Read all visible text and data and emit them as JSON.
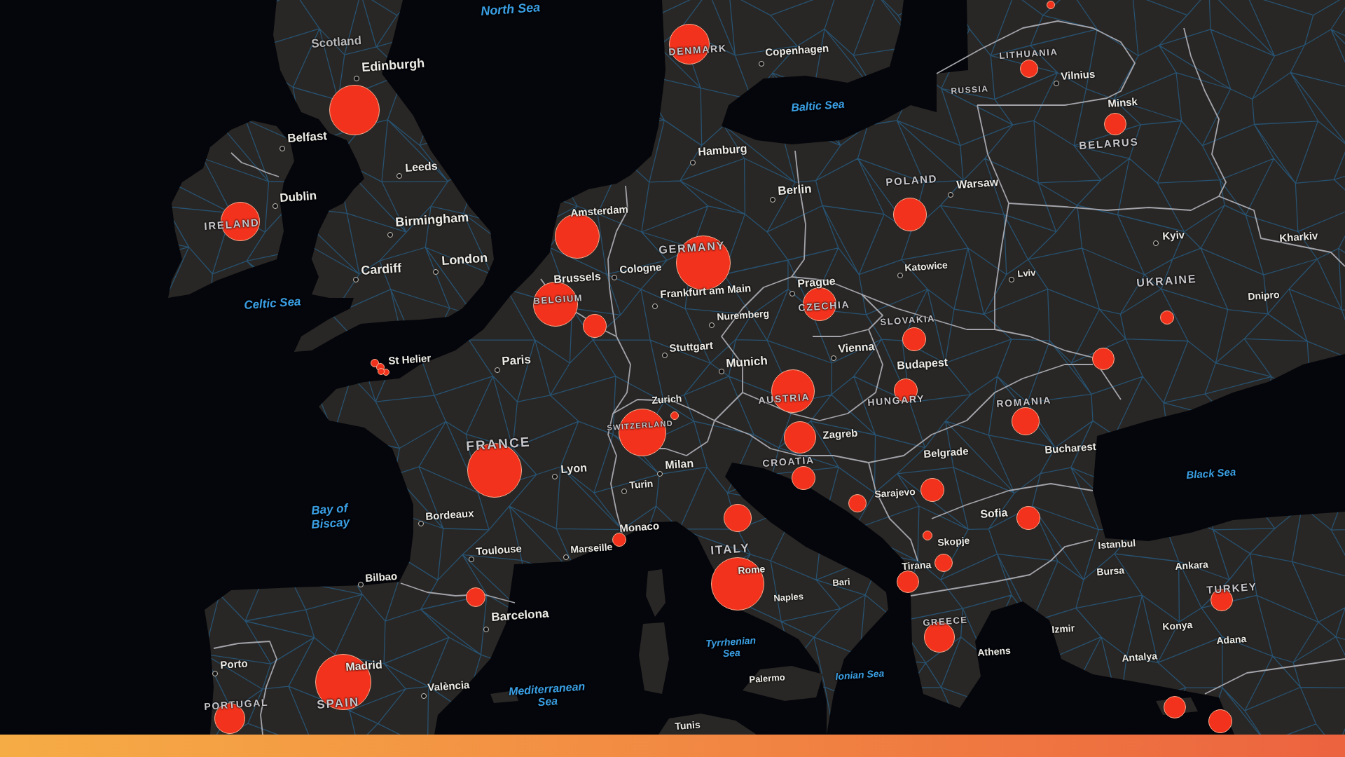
{
  "map": {
    "labels": [
      {
        "text": "North Sea",
        "kind": "sea"
      },
      {
        "text": "Scotland",
        "kind": "region"
      },
      {
        "text": "DENMARK",
        "kind": "country"
      },
      {
        "text": "Copenhagen",
        "kind": "city"
      },
      {
        "text": "LITHUANIA",
        "kind": "country"
      },
      {
        "text": "Edinburgh",
        "kind": "city"
      },
      {
        "text": "Vilnius",
        "kind": "city"
      },
      {
        "text": "RUSSIA",
        "kind": "country"
      },
      {
        "text": "Minsk",
        "kind": "city"
      },
      {
        "text": "Baltic Sea",
        "kind": "sea"
      },
      {
        "text": "Belfast",
        "kind": "city"
      },
      {
        "text": "BELARUS",
        "kind": "country"
      },
      {
        "text": "Hamburg",
        "kind": "city"
      },
      {
        "text": "Leeds",
        "kind": "city"
      },
      {
        "text": "POLAND",
        "kind": "country"
      },
      {
        "text": "Warsaw",
        "kind": "city"
      },
      {
        "text": "Berlin",
        "kind": "city"
      },
      {
        "text": "Dublin",
        "kind": "city"
      },
      {
        "text": "Amsterdam",
        "kind": "city"
      },
      {
        "text": "Birmingham",
        "kind": "city"
      },
      {
        "text": "IRELAND",
        "kind": "country"
      },
      {
        "text": "Kyiv",
        "kind": "city"
      },
      {
        "text": "Kharkiv",
        "kind": "city"
      },
      {
        "text": "GERMANY",
        "kind": "country"
      },
      {
        "text": "London",
        "kind": "city"
      },
      {
        "text": "Cologne",
        "kind": "city"
      },
      {
        "text": "Cardiff",
        "kind": "city"
      },
      {
        "text": "Katowice",
        "kind": "city"
      },
      {
        "text": "Brussels",
        "kind": "city"
      },
      {
        "text": "Lviv",
        "kind": "city"
      },
      {
        "text": "UKRAINE",
        "kind": "country"
      },
      {
        "text": "Prague",
        "kind": "city"
      },
      {
        "text": "Frankfurt am Main",
        "kind": "city"
      },
      {
        "text": "Dnipro",
        "kind": "city"
      },
      {
        "text": "BELGIUM",
        "kind": "country"
      },
      {
        "text": "CZECHIA",
        "kind": "country"
      },
      {
        "text": "Celtic Sea",
        "kind": "sea"
      },
      {
        "text": "Nuremberg",
        "kind": "city"
      },
      {
        "text": "SLOVAKIA",
        "kind": "country"
      },
      {
        "text": "Stuttgart",
        "kind": "city"
      },
      {
        "text": "Vienna",
        "kind": "city"
      },
      {
        "text": "Paris",
        "kind": "city"
      },
      {
        "text": "St Helier",
        "kind": "city"
      },
      {
        "text": "Munich",
        "kind": "city"
      },
      {
        "text": "Budapest",
        "kind": "city"
      },
      {
        "text": "Zurich",
        "kind": "city"
      },
      {
        "text": "AUSTRIA",
        "kind": "country"
      },
      {
        "text": "HUNGARY",
        "kind": "country"
      },
      {
        "text": "ROMANIA",
        "kind": "country"
      },
      {
        "text": "SWITZERLAND",
        "kind": "country"
      },
      {
        "text": "Zagreb",
        "kind": "city"
      },
      {
        "text": "FRANCE",
        "kind": "country"
      },
      {
        "text": "Belgrade",
        "kind": "city"
      },
      {
        "text": "Bucharest",
        "kind": "city"
      },
      {
        "text": "Milan",
        "kind": "city"
      },
      {
        "text": "Lyon",
        "kind": "city"
      },
      {
        "text": "CROATIA",
        "kind": "country"
      },
      {
        "text": "Black Sea",
        "kind": "sea"
      },
      {
        "text": "Turin",
        "kind": "city"
      },
      {
        "text": "Sarajevo",
        "kind": "city"
      },
      {
        "text": "Bay of Biscay",
        "kind": "sea"
      },
      {
        "text": "Bordeaux",
        "kind": "city"
      },
      {
        "text": "Sofia",
        "kind": "city"
      },
      {
        "text": "Monaco",
        "kind": "city"
      },
      {
        "text": "Skopje",
        "kind": "city"
      },
      {
        "text": "Istanbul",
        "kind": "city"
      },
      {
        "text": "Marseille",
        "kind": "city"
      },
      {
        "text": "ITALY",
        "kind": "country"
      },
      {
        "text": "Toulouse",
        "kind": "city"
      },
      {
        "text": "Tirana",
        "kind": "city"
      },
      {
        "text": "Ankara",
        "kind": "city"
      },
      {
        "text": "Rome",
        "kind": "city"
      },
      {
        "text": "Bursa",
        "kind": "city"
      },
      {
        "text": "Bilbao",
        "kind": "city"
      },
      {
        "text": "Bari",
        "kind": "city"
      },
      {
        "text": "TURKEY",
        "kind": "country"
      },
      {
        "text": "Naples",
        "kind": "city"
      },
      {
        "text": "Barcelona",
        "kind": "city"
      },
      {
        "text": "GREECE",
        "kind": "country"
      },
      {
        "text": "Konya",
        "kind": "city"
      },
      {
        "text": "Izmir",
        "kind": "city"
      },
      {
        "text": "Adana",
        "kind": "city"
      },
      {
        "text": "Tyrrhenian Sea",
        "kind": "sea"
      },
      {
        "text": "Athens",
        "kind": "city"
      },
      {
        "text": "Antalya",
        "kind": "city"
      },
      {
        "text": "Porto",
        "kind": "city"
      },
      {
        "text": "Madrid",
        "kind": "city"
      },
      {
        "text": "Ionian Sea",
        "kind": "sea"
      },
      {
        "text": "Palermo",
        "kind": "city"
      },
      {
        "text": "València",
        "kind": "city"
      },
      {
        "text": "Mediterranean Sea",
        "kind": "sea"
      },
      {
        "text": "SPAIN",
        "kind": "country"
      },
      {
        "text": "PORTUGAL",
        "kind": "country"
      },
      {
        "text": "Tunis",
        "kind": "city"
      }
    ]
  }
}
